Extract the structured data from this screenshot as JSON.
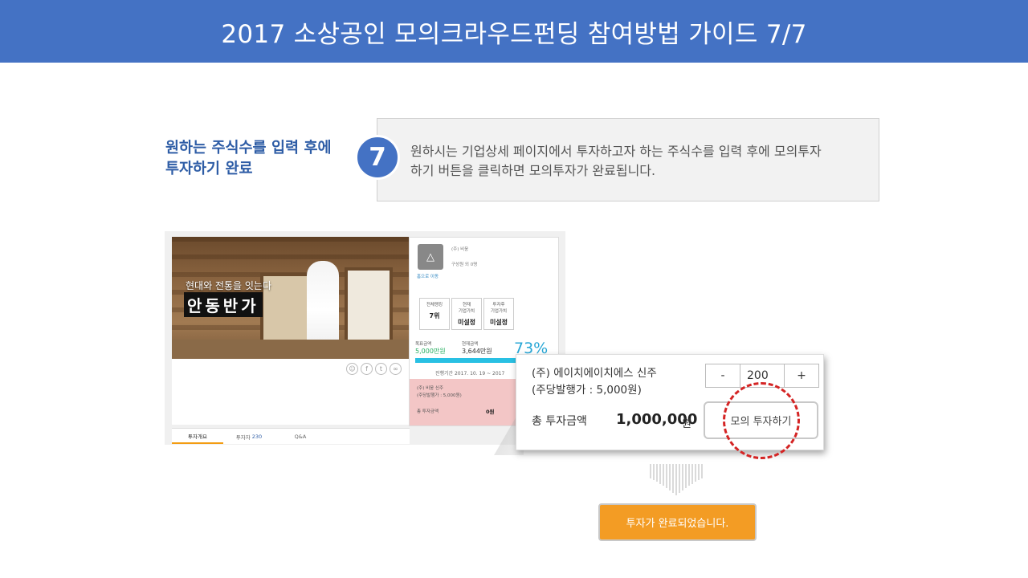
{
  "header": {
    "title": "2017 소상공인 모의크라우드펀딩 참여방법 가이드 7/7"
  },
  "step": {
    "heading_line1": "원하는 주식수를 입력 후에",
    "heading_line2": "투자하기 완료",
    "number": "7",
    "desc_line1": "원하시는 기업상세 페이지에서 투자하고자 하는 주식수를 입력 후에 모의투자",
    "desc_line2": "하기 버튼을 클릭하면 모의투자가 완료됩니다."
  },
  "shot": {
    "hero_sub": "현대와 전통을 잇는다",
    "hero_main": "안동반가",
    "share_icons": [
      "user-icon",
      "facebook-icon",
      "twitter-icon",
      "link-icon"
    ],
    "tabs": [
      {
        "label": "투자개요"
      },
      {
        "label": "투자자",
        "count": "230"
      },
      {
        "label": "Q&A"
      }
    ],
    "company": "(주) 비웅",
    "members": "구성원   외 0명",
    "home_link": "홈으로 이동",
    "stats": [
      {
        "label1": "전체랭킹",
        "label2": "",
        "value": "7위"
      },
      {
        "label1": "현재",
        "label2": "기업가치",
        "value": "미설정"
      },
      {
        "label1": "투자후",
        "label2": "기업가치",
        "value": "미설정"
      }
    ],
    "target_label": "목표금액",
    "target_value": "5,000만원",
    "current_label": "현재금액",
    "current_value": "3,644만원",
    "percent": "73%",
    "progress": 0.73,
    "period": "진행기간 2017. 10. 19 ~ 2017",
    "stock_name": "(주) 비웅 신주",
    "stock_price": "(주당발행가 : 5,000원)",
    "total_label": "총 투자금액",
    "total_value": "0원"
  },
  "zoom": {
    "company_line1": "(주) 에이치에이치에스 신주",
    "company_line2": "(주당발행가 : 5,000원)",
    "minus": "-",
    "quantity": "200",
    "plus": "+",
    "total_label": "총 투자금액",
    "total_value": "1,000,000",
    "total_unit": "원",
    "invest_button": "모의 투자하기"
  },
  "result": {
    "complete_button": "투자가 완료되었습니다."
  },
  "colors": {
    "header_bg": "#4472c4",
    "accent_orange": "#f39c24",
    "highlight_red": "#d42424",
    "progress_blue": "#29c0e3"
  }
}
